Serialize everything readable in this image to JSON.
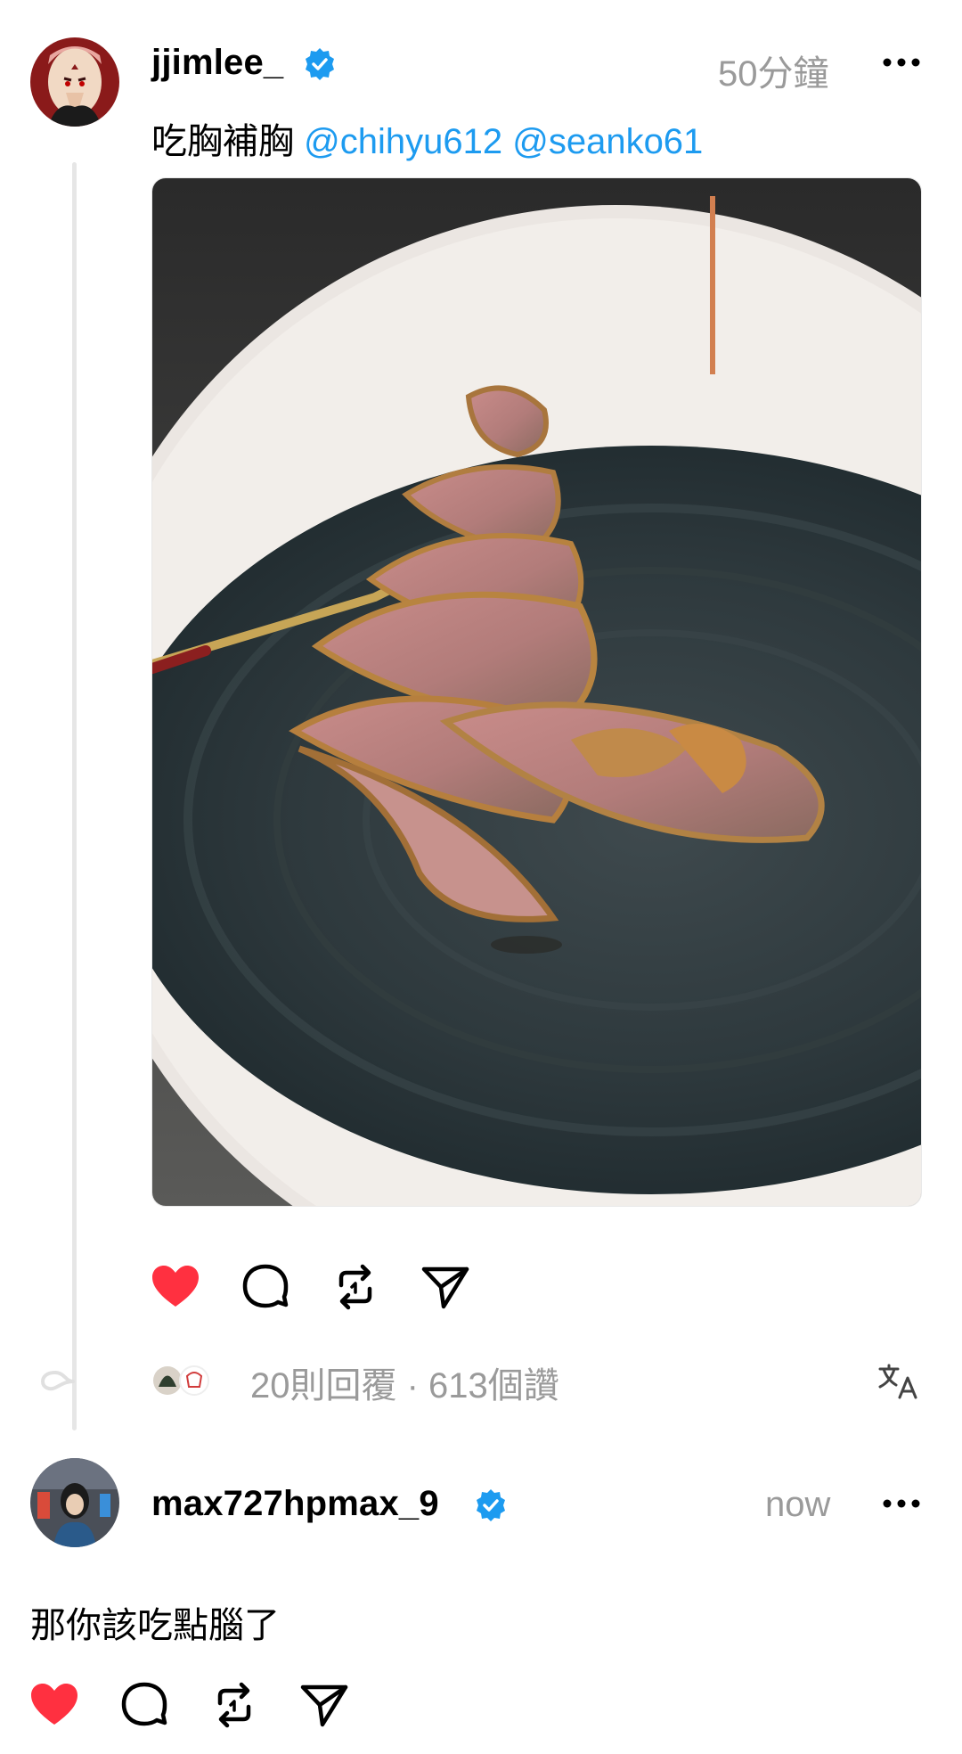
{
  "post": {
    "username": "jjimlee_",
    "verified": true,
    "time": "50分鐘",
    "text": "吃胸補胸",
    "mentions": [
      "@chihyu612",
      "@seanko61"
    ],
    "liked": true,
    "stats": "20則回覆 · 613個讚"
  },
  "reply": {
    "username": "max727hpmax_9",
    "verified": true,
    "time": "now",
    "text": "那你該吃點腦了",
    "liked": true
  },
  "colors": {
    "accent_blue": "#1d9bf0",
    "like_red": "#ff3040",
    "muted_gray": "#9a9a9a"
  },
  "icons": [
    "heart-icon",
    "comment-icon",
    "repost-icon",
    "share-icon",
    "more-icon",
    "verified-badge-icon",
    "translate-icon"
  ]
}
